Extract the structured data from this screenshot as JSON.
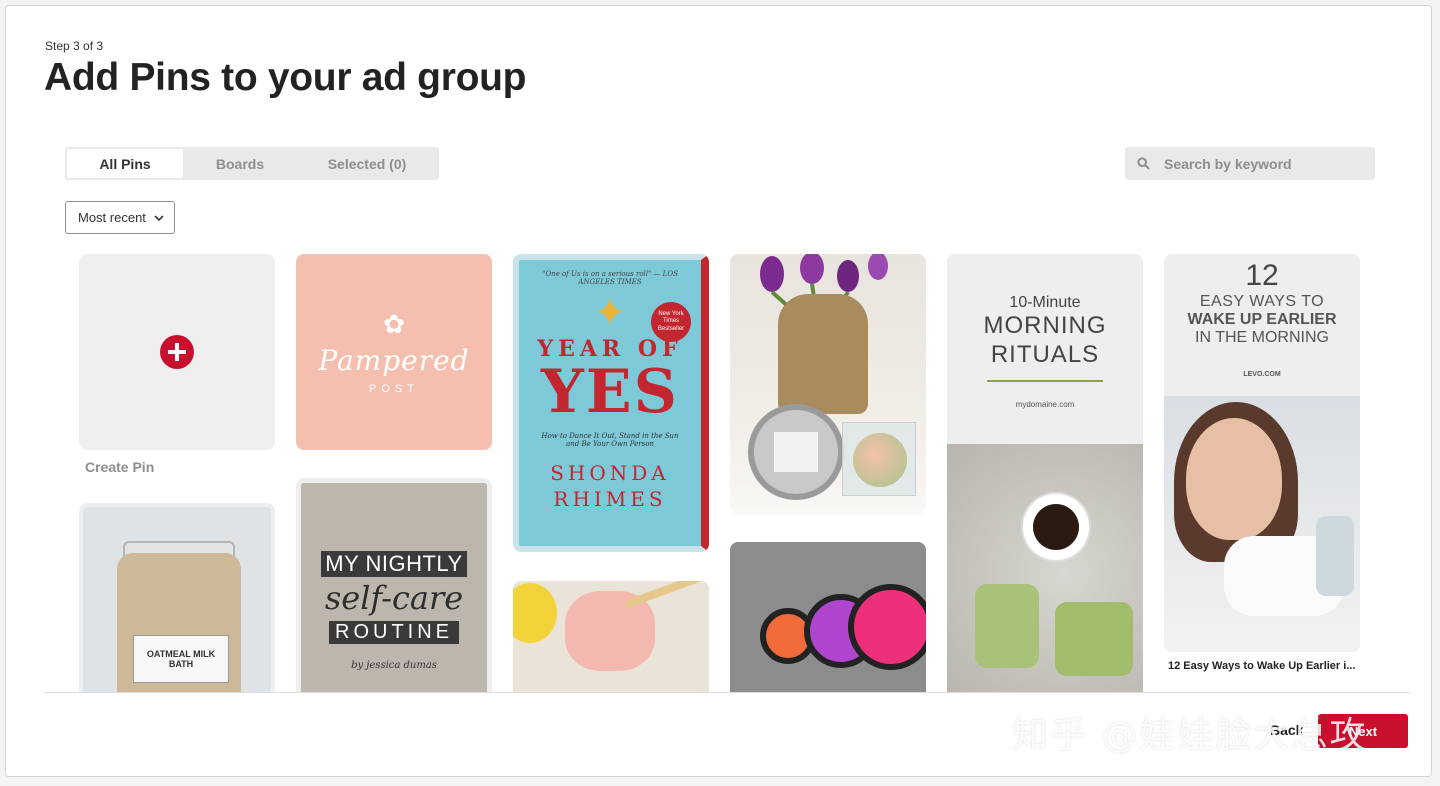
{
  "header": {
    "step": "Step 3 of 3",
    "title": "Add Pins to your ad group"
  },
  "tabs": [
    {
      "label": "All Pins",
      "active": true
    },
    {
      "label": "Boards",
      "active": false
    },
    {
      "label": "Selected (0)",
      "active": false
    }
  ],
  "search": {
    "placeholder": "Search by keyword",
    "icon": "search-icon"
  },
  "sort": {
    "selected": "Most recent",
    "icon": "chevron-down-icon"
  },
  "create_pin": {
    "label": "Create Pin",
    "icon": "plus-circle-icon",
    "accent": "#c8102e"
  },
  "pins": {
    "pampered": {
      "line1": "Pampered",
      "line2": "POST"
    },
    "book": {
      "blurb": "\"One of Us is on a serious roll\" — LOS ANGELES TIMES",
      "badge": "New York Times Bestseller",
      "line1": "YEAR OF",
      "line2": "YES",
      "subtitle": "How to Dance It Out, Stand in the Sun and Be Your Own Person",
      "author1": "SHONDA",
      "author2": "RHIMES"
    },
    "morning": {
      "line1": "10-Minute",
      "line2": "MORNING",
      "line3": "RITUALS",
      "site": "mydomaine.com"
    },
    "wake": {
      "n": "12",
      "line1": "EASY WAYS TO",
      "line2": "WAKE UP EARLIER",
      "line3": "IN THE MORNING",
      "site": "LEVO.COM",
      "caption": "12 Easy Ways to Wake Up Earlier i..."
    },
    "jar": {
      "label": "OATMEAL MILK BATH"
    },
    "nightly": {
      "line1": "MY NIGHTLY",
      "line2": "self-care",
      "line3": "ROUTINE",
      "by": "by jessica dumas"
    }
  },
  "footer": {
    "back": "Back",
    "next": "Next"
  },
  "watermark": "知乎 @娃娃脸大总攻",
  "colors": {
    "accent": "#c8102e",
    "tab_bg": "#e9e9e9",
    "create_bg": "#efefef",
    "pampered_bg": "#f4bfae"
  }
}
